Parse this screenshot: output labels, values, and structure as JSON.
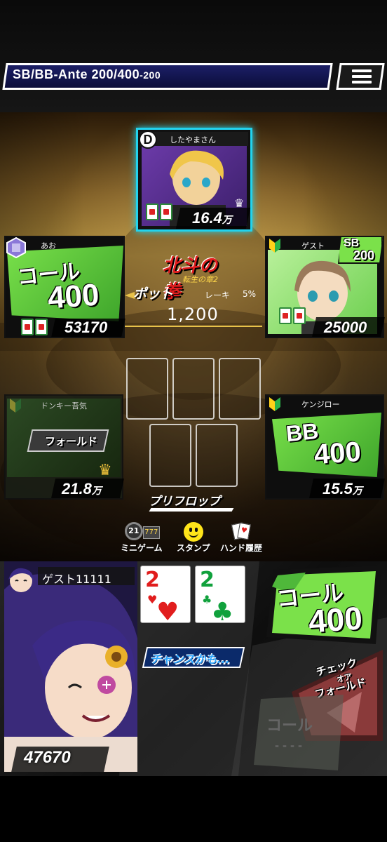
{
  "header": {
    "blinds_prefix": "SB/BB-Ante",
    "blinds_main": "200/400",
    "blinds_ante": "-200",
    "menu_icon": "hamburger-icon"
  },
  "seats": {
    "top": {
      "dealer_badge": "D",
      "name": "したやまさん",
      "stack": "16.4",
      "stack_unit": "万"
    },
    "left_upper": {
      "name": "あお",
      "action": "コール",
      "bet": "400",
      "stack": "53170"
    },
    "right_upper": {
      "name": "ゲスト",
      "blind_label": "SB",
      "blind_amount": "200",
      "stack": "25000"
    },
    "left_lower": {
      "name": "ドンキー吾気",
      "action": "フォールド",
      "stack": "21.8",
      "stack_unit": "万"
    },
    "right_lower": {
      "name": "ケンジロー",
      "action": "BB",
      "bet": "400",
      "stack": "15.5",
      "stack_unit": "万"
    }
  },
  "pot": {
    "label": "ポット",
    "rake_label": "レーキ",
    "rake_value": "5%",
    "amount": "1,200"
  },
  "logo": {
    "title": "北斗の拳",
    "subtitle": "転生の章2"
  },
  "street": "プリフロップ",
  "tools": [
    {
      "label": "ミニゲーム",
      "icon": "minigame-icon"
    },
    {
      "label": "スタンプ",
      "icon": "smiley-icon"
    },
    {
      "label": "ハンド履歴",
      "icon": "cards-icon"
    }
  ],
  "hero": {
    "name": "ゲスト11111",
    "stack": "47670",
    "cards": [
      {
        "rank": "2",
        "suit": "♥",
        "color": "#e11d1d"
      },
      {
        "rank": "2",
        "suit": "♣",
        "color": "#10a13c"
      }
    ],
    "hint": "チャンスかも..."
  },
  "actions": {
    "call_label": "コール",
    "call_amount": "400",
    "check_or_fold": [
      "チェック",
      "オア",
      "フォールド"
    ],
    "disabled_call_label": "コール",
    "disabled_call_amount": "- - - -"
  },
  "colors": {
    "accent_green": "#7be14a",
    "active_seat_border": "#22d3ee",
    "pot_line": "#e8c24a",
    "hint_blue": "#2ea8ff"
  }
}
